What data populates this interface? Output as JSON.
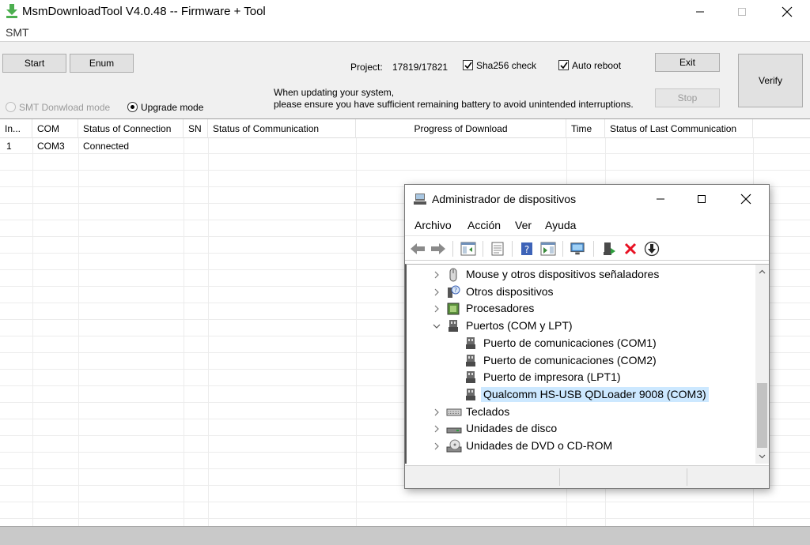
{
  "window": {
    "title": "MsmDownloadTool V4.0.48 -- Firmware + Tool",
    "menu": "SMT"
  },
  "toolbar": {
    "start_label": "Start",
    "enum_label": "Enum",
    "project_label": "Project:",
    "project_value": "17819/17821",
    "sha256_label": "Sha256 check",
    "sha256_checked": true,
    "auto_reboot_label": "Auto reboot",
    "auto_reboot_checked": true,
    "exit_label": "Exit",
    "stop_label": "Stop",
    "verify_label": "Verify",
    "notice_line1": "When updating your system,",
    "notice_line2": "please ensure you have sufficient remaining battery to avoid unintended interruptions.",
    "smt_mode_label": "SMT Donwload mode",
    "upgrade_mode_label": "Upgrade mode",
    "selected_mode": "upgrade"
  },
  "grid": {
    "columns": [
      "In...",
      "COM",
      "Status of Connection",
      "SN",
      "Status of Communication",
      "Progress of Download",
      "Time",
      "Status of Last Communication"
    ],
    "rows": [
      {
        "index": "1",
        "com": "COM3",
        "connection": "Connected"
      }
    ]
  },
  "device_manager": {
    "title": "Administrador de dispositivos",
    "menu": [
      "Archivo",
      "Acción",
      "Ver",
      "Ayuda"
    ],
    "tree": [
      {
        "label": "Mouse y otros dispositivos señaladores",
        "icon": "mouse-icon",
        "expanded": false
      },
      {
        "label": "Otros dispositivos",
        "icon": "unknown-device-icon",
        "expanded": false
      },
      {
        "label": "Procesadores",
        "icon": "processor-icon",
        "expanded": false
      },
      {
        "label": "Puertos (COM y LPT)",
        "icon": "port-icon",
        "expanded": true
      },
      {
        "label": "Puerto de comunicaciones (COM1)",
        "icon": "port-icon",
        "child": true
      },
      {
        "label": "Puerto de comunicaciones (COM2)",
        "icon": "port-icon",
        "child": true
      },
      {
        "label": "Puerto de impresora (LPT1)",
        "icon": "port-icon",
        "child": true
      },
      {
        "label": "Qualcomm HS-USB QDLoader 9008 (COM3)",
        "icon": "port-icon",
        "child": true,
        "selected": true
      },
      {
        "label": "Teclados",
        "icon": "keyboard-icon",
        "expanded": false
      },
      {
        "label": "Unidades de disco",
        "icon": "disk-icon",
        "expanded": false
      },
      {
        "label": "Unidades de DVD o CD-ROM",
        "icon": "dvd-icon",
        "expanded": false
      }
    ]
  },
  "colors": {
    "selection": "#cce8ff",
    "toolbar_bg": "#f0f0f0",
    "status_bg": "#c9c9c9",
    "app_icon_green": "#4caf50",
    "delete_red": "#e81123"
  }
}
